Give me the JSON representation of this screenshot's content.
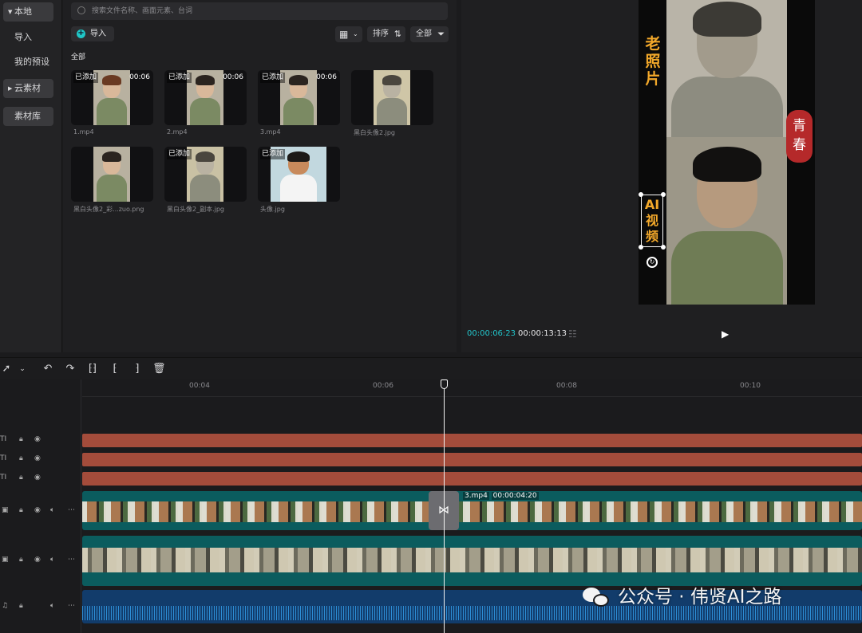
{
  "sidebar": {
    "items": [
      {
        "label": "本地",
        "expanded": true
      },
      {
        "label": "导入"
      },
      {
        "label": "我的预设"
      },
      {
        "label": "云素材",
        "expanded": false
      },
      {
        "label": "素材库"
      }
    ]
  },
  "media": {
    "search_placeholder": "搜索文件名称、画面元素、台词",
    "import_label": "导入",
    "sort_label": "排序",
    "filter_label": "全部",
    "section_label": "全部",
    "items": [
      {
        "name": "1.mp4",
        "badge": "已添加",
        "duration": "00:06"
      },
      {
        "name": "2.mp4",
        "badge": "已添加",
        "duration": "00:06"
      },
      {
        "name": "3.mp4",
        "badge": "已添加",
        "duration": "00:06"
      },
      {
        "name": "黑白头像2.jpg",
        "badge": "",
        "duration": ""
      },
      {
        "name": "黑白头像2_彩...zuo.png",
        "badge": "",
        "duration": ""
      },
      {
        "name": "黑白头像2_副本.jpg",
        "badge": "已添加",
        "duration": ""
      },
      {
        "name": "头像.jpg",
        "badge": "已添加",
        "duration": ""
      }
    ]
  },
  "preview": {
    "title_text": "老照片",
    "seal_text": "青春",
    "ai_label": "AI视频",
    "current_time": "00:00:06:23",
    "total_time": "00:00:13:13"
  },
  "timeline": {
    "ruler_labels": [
      "00:04",
      "00:06",
      "00:08",
      "00:10"
    ],
    "clip_tag_name": "3.mp4",
    "clip_tag_duration": "00:00:04:20",
    "track_text_label": "TI"
  },
  "watermark": "公众号 · 伟贤AI之路",
  "colors": {
    "accent_cyan": "#22c3c9",
    "text_clip": "#a44c3b",
    "video_clip": "#0b5c5e",
    "audio_clip": "#123c6b",
    "title_orange": "#f2a82a",
    "seal_red": "#b5292a"
  }
}
